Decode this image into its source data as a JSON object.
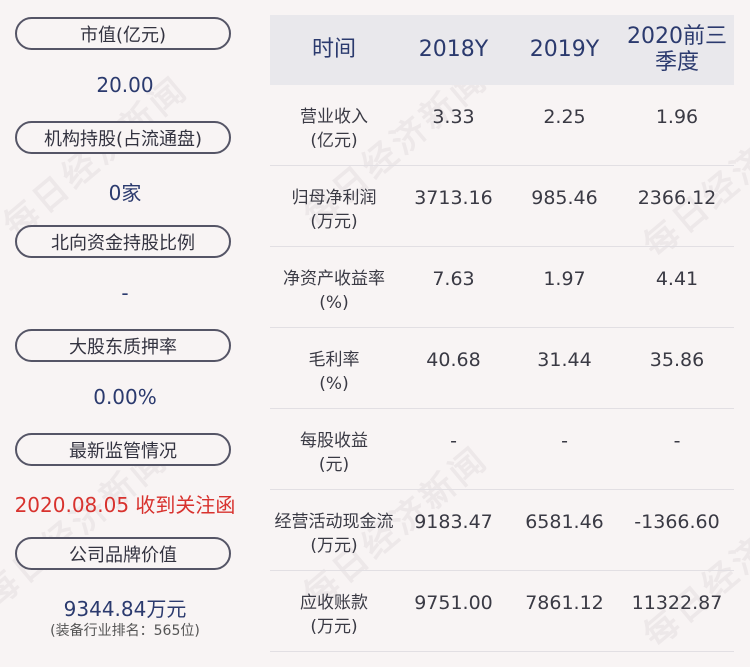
{
  "left": {
    "items": [
      {
        "label": "市值(亿元)",
        "value": "20.00",
        "color": "#2b3a6e"
      },
      {
        "label": "机构持股(占流通盘)",
        "value": "0家",
        "color": "#2b3a6e"
      },
      {
        "label": "北向资金持股比例",
        "value": "-",
        "color": "#2b3a6e"
      },
      {
        "label": "大股东质押率",
        "value": "0.00%",
        "color": "#2b3a6e"
      },
      {
        "label": "最新监管情况",
        "value": "2020.08.05 收到关注函",
        "color": "#d8322e"
      },
      {
        "label": "公司品牌价值",
        "value": "9344.84万元",
        "color": "#2b3a6e"
      }
    ],
    "brand_note": "(装备行业排名：565位)"
  },
  "table": {
    "headers": [
      "时间",
      "2018Y",
      "2019Y",
      "2020前三季度"
    ],
    "rows": [
      {
        "label": [
          "营业收入",
          "(亿元)"
        ],
        "values": [
          "3.33",
          "2.25",
          "1.96"
        ]
      },
      {
        "label": [
          "归母净利润",
          "(万元)"
        ],
        "values": [
          "3713.16",
          "985.46",
          "2366.12"
        ]
      },
      {
        "label": [
          "净资产收益率",
          "(%)"
        ],
        "values": [
          "7.63",
          "1.97",
          "4.41"
        ]
      },
      {
        "label": [
          "毛利率",
          "(%)"
        ],
        "values": [
          "40.68",
          "31.44",
          "35.86"
        ]
      },
      {
        "label": [
          "每股收益",
          "(元)"
        ],
        "values": [
          "-",
          "-",
          "-"
        ]
      },
      {
        "label": [
          "经营活动现金流",
          "(万元)"
        ],
        "values": [
          "9183.47",
          "6581.46",
          "-1366.60"
        ]
      },
      {
        "label": [
          "应收账款",
          "(万元)"
        ],
        "values": [
          "9751.00",
          "7861.12",
          "11322.87"
        ]
      }
    ]
  },
  "watermark": "每日经济新闻"
}
